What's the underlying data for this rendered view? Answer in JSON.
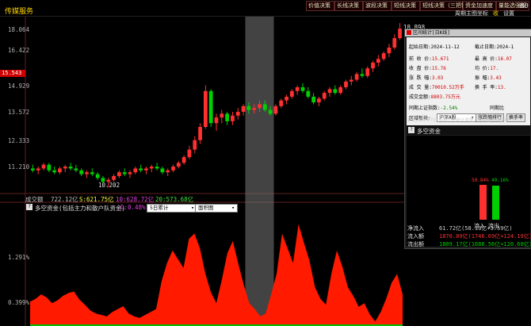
{
  "app": {
    "title": "传媒服务"
  },
  "top_buttons": [
    "价值决策",
    "长线决策",
    "波段决策",
    "短线决策",
    "短线决策（三把锁）",
    "资金加速度",
    "量能选强股"
  ],
  "tools": [
    "周期",
    "主图",
    "坐标",
    "收",
    "设置"
  ],
  "tools_extra": "B0",
  "chart_data": {
    "type": "candlestick",
    "y_ticks": [
      "18.064",
      "16.422",
      "14.929",
      "13.572",
      "12.333",
      "11.210"
    ],
    "current_price": "15.543",
    "high_label": "18.898",
    "low_label": "10.202",
    "ylim": [
      10.0,
      18.9
    ],
    "candles": [
      [
        11.2,
        11.4,
        11.0,
        11.1
      ],
      [
        11.1,
        11.3,
        10.9,
        11.2
      ],
      [
        11.2,
        11.5,
        11.1,
        11.4
      ],
      [
        11.4,
        11.5,
        11.0,
        11.1
      ],
      [
        11.1,
        11.3,
        10.9,
        11.0
      ],
      [
        11.0,
        11.3,
        10.9,
        11.2
      ],
      [
        11.2,
        11.4,
        11.0,
        11.3
      ],
      [
        11.3,
        11.5,
        11.1,
        11.2
      ],
      [
        11.2,
        11.4,
        11.0,
        11.1
      ],
      [
        11.1,
        11.2,
        10.8,
        10.9
      ],
      [
        10.9,
        11.1,
        10.7,
        11.0
      ],
      [
        11.0,
        11.2,
        10.8,
        10.9
      ],
      [
        10.9,
        11.0,
        10.6,
        10.7
      ],
      [
        10.7,
        10.8,
        10.4,
        10.5
      ],
      [
        10.5,
        10.7,
        10.2,
        10.6
      ],
      [
        10.6,
        10.9,
        10.5,
        10.8
      ],
      [
        10.8,
        11.1,
        10.7,
        11.0
      ],
      [
        11.0,
        11.2,
        10.8,
        10.9
      ],
      [
        10.9,
        11.1,
        10.7,
        11.0
      ],
      [
        11.0,
        11.3,
        10.9,
        11.2
      ],
      [
        11.2,
        11.4,
        11.0,
        11.1
      ],
      [
        11.1,
        11.3,
        10.9,
        11.2
      ],
      [
        11.2,
        11.4,
        11.0,
        11.3
      ],
      [
        11.3,
        11.5,
        11.1,
        11.2
      ],
      [
        11.2,
        11.3,
        10.9,
        11.0
      ],
      [
        11.0,
        11.2,
        10.8,
        11.1
      ],
      [
        11.1,
        11.4,
        11.0,
        11.3
      ],
      [
        11.3,
        11.6,
        11.2,
        11.5
      ],
      [
        11.5,
        11.9,
        11.4,
        11.8
      ],
      [
        11.8,
        12.4,
        11.7,
        12.2
      ],
      [
        12.2,
        12.9,
        12.0,
        12.7
      ],
      [
        12.7,
        13.6,
        12.5,
        13.4
      ],
      [
        13.4,
        15.6,
        13.3,
        15.3
      ],
      [
        15.3,
        15.4,
        13.4,
        13.6
      ],
      [
        13.6,
        14.1,
        13.2,
        13.9
      ],
      [
        13.9,
        14.3,
        13.6,
        14.1
      ],
      [
        14.1,
        14.2,
        13.5,
        13.7
      ],
      [
        13.7,
        14.2,
        13.5,
        14.0
      ],
      [
        14.0,
        14.4,
        13.8,
        14.2
      ],
      [
        14.2,
        14.6,
        14.0,
        14.5
      ],
      [
        14.5,
        14.7,
        14.1,
        14.3
      ],
      [
        14.3,
        14.6,
        14.1,
        14.4
      ],
      [
        14.4,
        14.8,
        14.2,
        14.6
      ],
      [
        14.6,
        14.8,
        14.2,
        14.3
      ],
      [
        14.3,
        14.5,
        14.0,
        14.1
      ],
      [
        14.1,
        14.6,
        14.0,
        14.5
      ],
      [
        14.5,
        14.9,
        14.4,
        14.8
      ],
      [
        14.8,
        15.1,
        14.6,
        15.0
      ],
      [
        15.0,
        15.4,
        14.9,
        15.3
      ],
      [
        15.3,
        15.6,
        15.1,
        15.5
      ],
      [
        15.5,
        15.7,
        15.2,
        15.3
      ],
      [
        15.3,
        15.5,
        14.9,
        15.0
      ],
      [
        15.0,
        15.2,
        14.6,
        14.7
      ],
      [
        14.7,
        15.0,
        14.5,
        14.9
      ],
      [
        14.9,
        15.3,
        14.8,
        15.2
      ],
      [
        15.2,
        15.5,
        15.0,
        15.4
      ],
      [
        15.4,
        15.6,
        15.1,
        15.2
      ],
      [
        15.2,
        15.6,
        15.1,
        15.5
      ],
      [
        15.5,
        15.9,
        15.4,
        15.8
      ],
      [
        15.8,
        16.1,
        15.6,
        15.9
      ],
      [
        15.9,
        16.3,
        15.8,
        16.2
      ],
      [
        16.2,
        16.5,
        16.0,
        16.1
      ],
      [
        16.1,
        16.6,
        16.0,
        16.5
      ],
      [
        16.5,
        16.9,
        16.3,
        16.8
      ],
      [
        16.8,
        17.2,
        16.6,
        17.0
      ],
      [
        17.0,
        17.4,
        16.9,
        17.3
      ],
      [
        17.3,
        17.8,
        17.1,
        17.6
      ],
      [
        17.6,
        18.3,
        17.5,
        18.1
      ],
      [
        18.1,
        18.9,
        18.0,
        18.6
      ]
    ],
    "highlight_range": [
      40,
      44
    ]
  },
  "volume": {
    "label": "成交额",
    "value": "722.12亿",
    "s_val": "S:621.75亿",
    "m10_val": "10:628.72亿",
    "m20_val": "20:573.68亿"
  },
  "flow": {
    "icon": "?",
    "title": "多空资金(包括主力和散户队资金)",
    "d_val": "D:0.48%",
    "sel1": "5日累计",
    "sel2": "面积图",
    "y_ticks": [
      "1.291%",
      "0.399%"
    ],
    "values": [
      0.32,
      0.36,
      0.42,
      0.38,
      0.3,
      0.34,
      0.4,
      0.44,
      0.46,
      0.35,
      0.28,
      0.2,
      0.16,
      0.14,
      0.12,
      0.18,
      0.22,
      0.26,
      0.16,
      0.12,
      0.1,
      0.14,
      0.18,
      0.22,
      0.6,
      0.85,
      1.02,
      0.9,
      0.78,
      1.18,
      1.25,
      1.05,
      0.7,
      0.45,
      0.3,
      0.62,
      0.98,
      1.15,
      0.84,
      0.55,
      0.3,
      0.22,
      0.12,
      0.16,
      0.42,
      0.7,
      1.25,
      1.05,
      0.85,
      1.38,
      1.12,
      0.88,
      0.52,
      0.36,
      0.28,
      0.7,
      1.02,
      0.8,
      0.52,
      0.4,
      0.25,
      0.3,
      0.15,
      0.05,
      0.18,
      0.36,
      0.58,
      0.7,
      0.42
    ]
  },
  "popup": {
    "title": "区间统计[日K线]",
    "start_label": "起始日期:",
    "start_date": "2024-11-12",
    "end_label": "截止日期:",
    "end_date": "2024-1",
    "open_label": "前 收 价:",
    "open_val": "15.671",
    "high_label": "最 高 价:",
    "high_val": "16.07",
    "low_label": "收 盘 价:",
    "low_val": "15.76",
    "low2_label": "均 价:",
    "low2_val": "17.",
    "amp_label": "涨 跌 幅:",
    "amp_val": "3.03",
    "amp2_label": "振 幅:",
    "amp2_val": "3.43",
    "vol_label": "成 交 量:",
    "vol_val": "70010.52万手",
    "vol2_label": "换 手 率:",
    "vol2_val": "13.",
    "amt_label": "成交金额:",
    "amt_val": "8803.75万元",
    "comp_label": "同期上证指数:",
    "comp_val": "-2.54%",
    "comp2_label": "同期比",
    "sector_label": "区域板块:",
    "sector_val": "沪深A股",
    "btn1": "涨跌幅排行",
    "btn2": "换手率",
    "note": "区域板块为区间期内的统计数据，关闭窗口后重算",
    "panel_title": "多空资金",
    "bar_in_pct": "50.84%",
    "bar_out_pct": "49.16%",
    "bar_in_label": "流入",
    "bar_out_label": "流出",
    "rows": [
      {
        "label": "净流入",
        "value": "61.72亿(58.13亿+3.59亿)"
      },
      {
        "label": "流入额",
        "value": "1870.89亿(1746.69亿+124.19亿)"
      },
      {
        "label": "流出额",
        "value": "1809.17亿(1688.56亿+120.60亿)"
      }
    ]
  },
  "colors": {
    "up": "#ff3030",
    "down": "#00d000",
    "flow": "#ff1a00",
    "highlight": "#7a7a7a"
  }
}
